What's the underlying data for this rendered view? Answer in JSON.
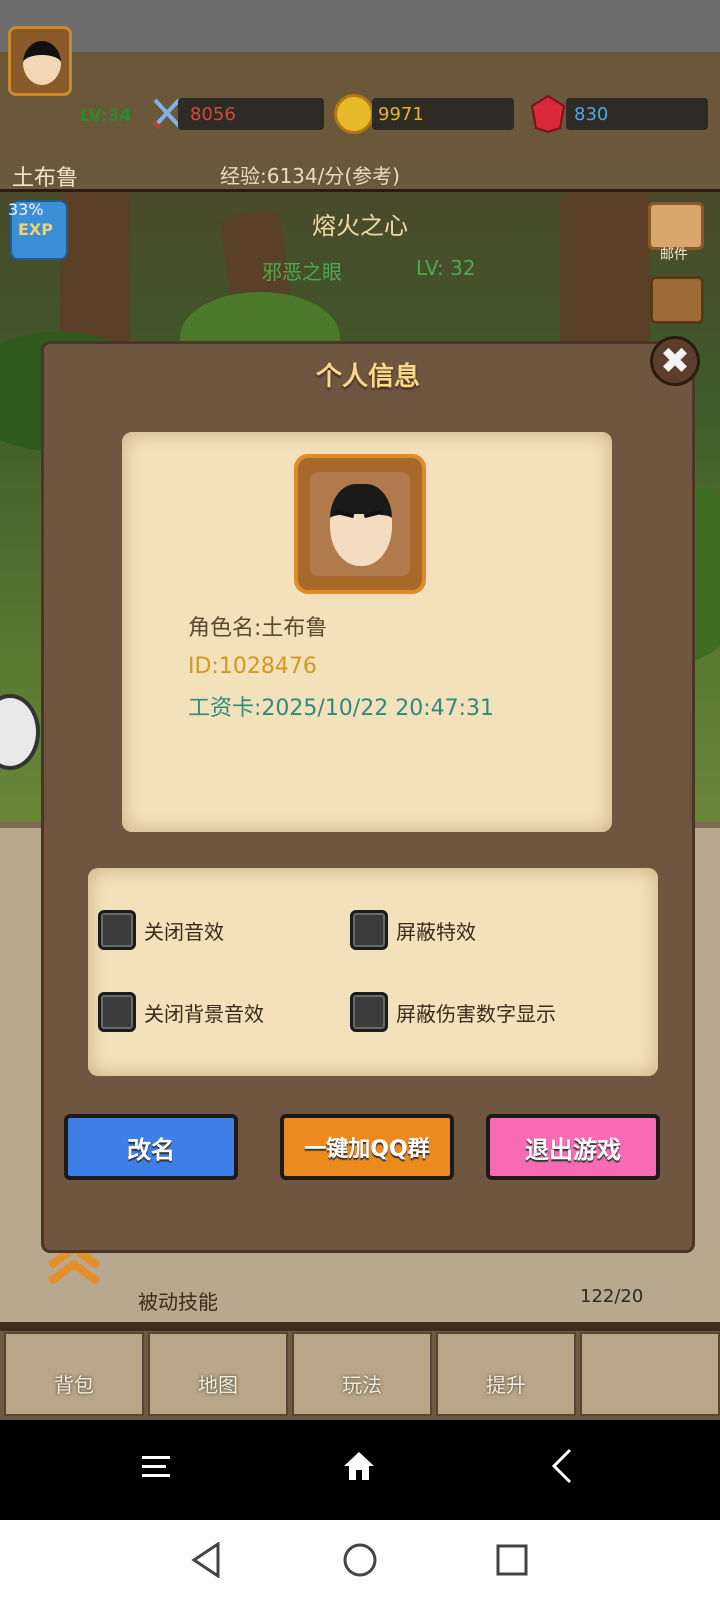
{
  "hud": {
    "level": "LV:34",
    "power": "8056",
    "gold": "9971",
    "gems": "830",
    "player_name": "土布鲁",
    "exp_rate": "经验:6134/分(参考)",
    "exp_percent": "33%",
    "exp_badge": "EXP"
  },
  "scene": {
    "title": "熔火之心",
    "boss_name": "邪恶之眼",
    "boss_level": "LV: 32",
    "mail_label": "邮件"
  },
  "modal": {
    "title": "个人信息",
    "close_symbol": "✖",
    "role_name": "角色名:土布鲁",
    "role_id": "ID:1028476",
    "wage_card": "工资卡:2025/10/22 20:47:31",
    "settings": [
      {
        "label": "关闭音效",
        "checked": false
      },
      {
        "label": "屏蔽特效",
        "checked": false
      },
      {
        "label": "关闭背景音效",
        "checked": false
      },
      {
        "label": "屏蔽伤害数字显示",
        "checked": false
      }
    ],
    "buttons": {
      "rename": "改名",
      "join_qq": "一键加QQ群",
      "exit_game": "退出游戏"
    }
  },
  "panel": {
    "passive_skills": "被动技能",
    "skill_points": "122/20"
  },
  "bottom_nav": {
    "tabs": [
      "背包",
      "地图",
      "玩法",
      "提升"
    ]
  },
  "colors": {
    "modal_bg": "#6f5641",
    "parchment": "#f2e1bb",
    "title_gold": "#f9d889",
    "rename_blue": "#3d7fe6",
    "qq_orange": "#ea8a1f",
    "exit_pink": "#f76ab4"
  }
}
